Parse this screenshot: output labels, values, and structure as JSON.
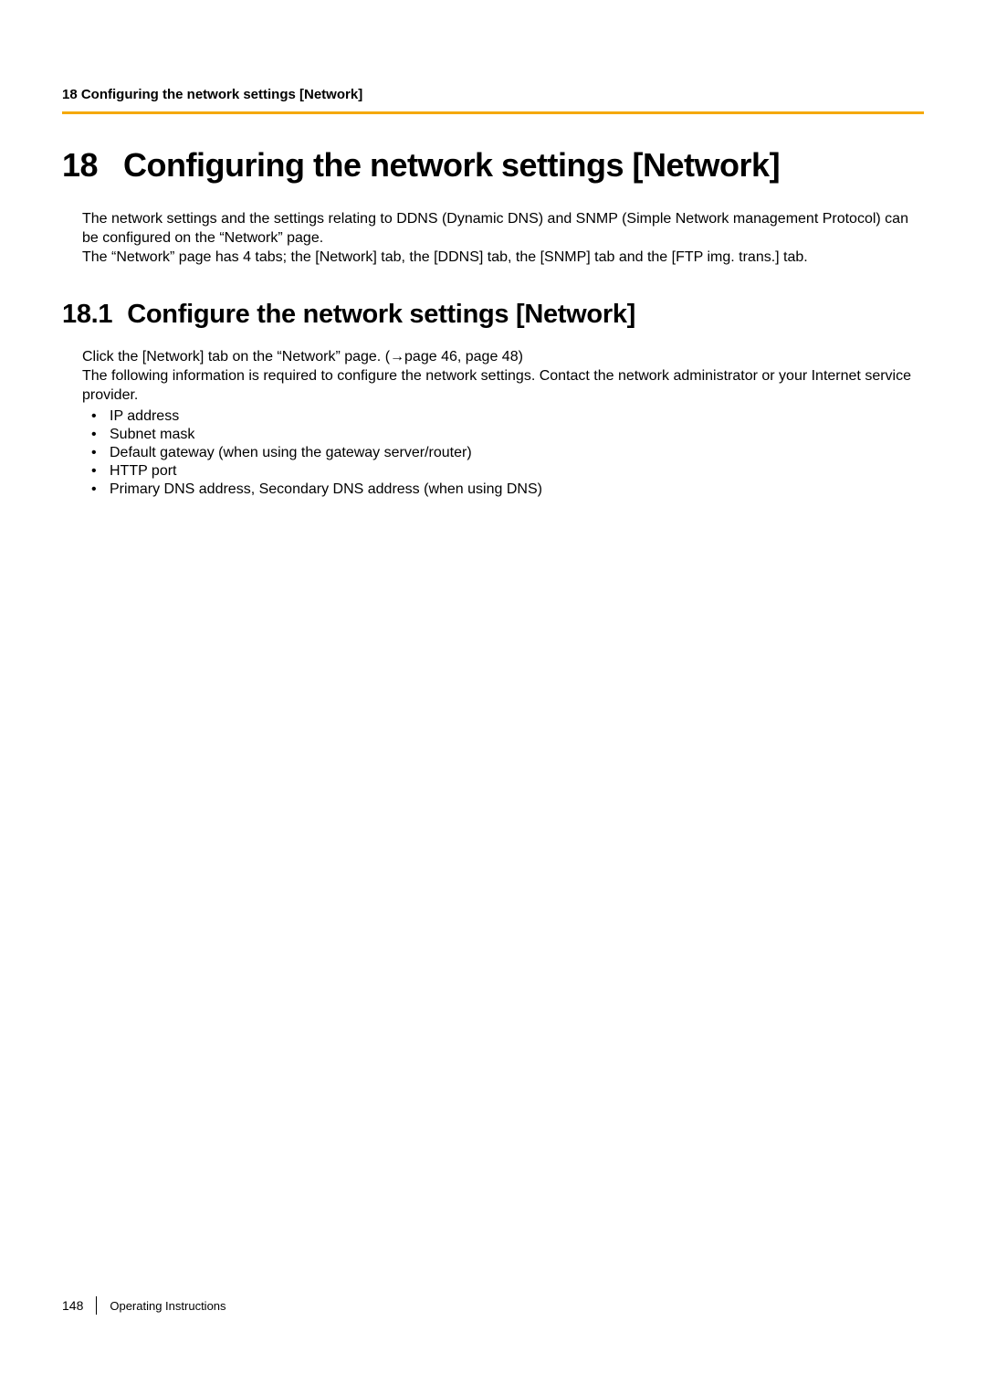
{
  "header": {
    "running_title": "18 Configuring the network settings [Network]"
  },
  "chapter": {
    "number": "18",
    "title": "Configuring the network settings [Network]",
    "intro_p1": "The network settings and the settings relating to DDNS (Dynamic DNS) and SNMP (Simple Network management Protocol) can be configured on the “Network” page.",
    "intro_p2": "The “Network” page has 4 tabs; the [Network] tab, the [DDNS] tab, the [SNMP] tab and the [FTP img. trans.] tab."
  },
  "section": {
    "number": "18.1",
    "title": "Configure the network settings [Network]",
    "line1_a": "Click the [Network] tab on the “Network” page. (",
    "line1_arrow": "→",
    "line1_b": "page 46, page 48)",
    "line2": "The following information is required to configure the network settings. Contact the network administrator or your Internet service provider.",
    "bullets": [
      "IP address",
      "Subnet mask",
      "Default gateway (when using the gateway server/router)",
      "HTTP port",
      "Primary DNS address, Secondary DNS address (when using DNS)"
    ]
  },
  "footer": {
    "page_number": "148",
    "label": "Operating Instructions"
  }
}
